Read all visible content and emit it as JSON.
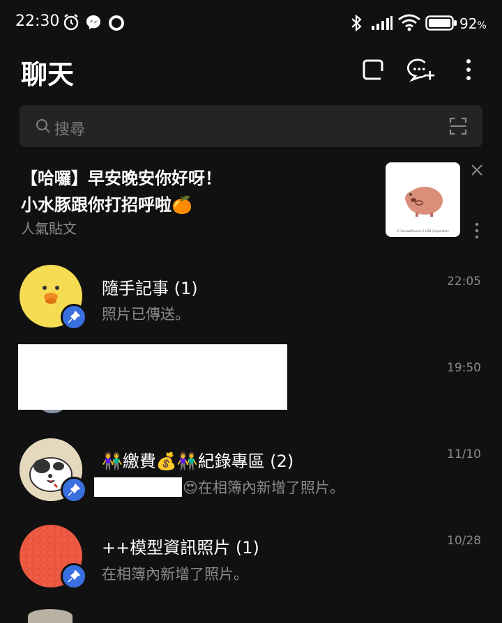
{
  "status": {
    "time": "22:30",
    "battery": "92",
    "battery_unit": "%"
  },
  "header": {
    "title": "聊天"
  },
  "search": {
    "placeholder": "搜尋"
  },
  "promo": {
    "line1": "【哈囉】早安晚安你好呀！",
    "line2": "小水豚跟你打招呼啦🍊",
    "sub": "人氣貼文",
    "thumb_caption": "© SeesawPeanut © LINE Corporation"
  },
  "chats": [
    {
      "name": "隨手記事 (1)",
      "message": "照片已傳送。",
      "time": "22:05",
      "pinned": true,
      "avatar": "sally-icon"
    },
    {
      "name": "",
      "message": "",
      "time": "19:50",
      "pinned": true,
      "avatar": "redacted"
    },
    {
      "name": "👫繳費💰👫紀錄專區 (2)",
      "message": "😍在相簿內新增了照片。",
      "time": "11/10",
      "pinned": true,
      "avatar": "dog-icon"
    },
    {
      "name": "++模型資訊照片 (1)",
      "message": "在相簿內新增了照片。",
      "time": "10/28",
      "pinned": true,
      "avatar": "red-circle"
    }
  ],
  "colors": {
    "background": "#111111",
    "pin": "#3a6fe0",
    "search_bg": "#242424",
    "muted": "#8a8a8a"
  }
}
